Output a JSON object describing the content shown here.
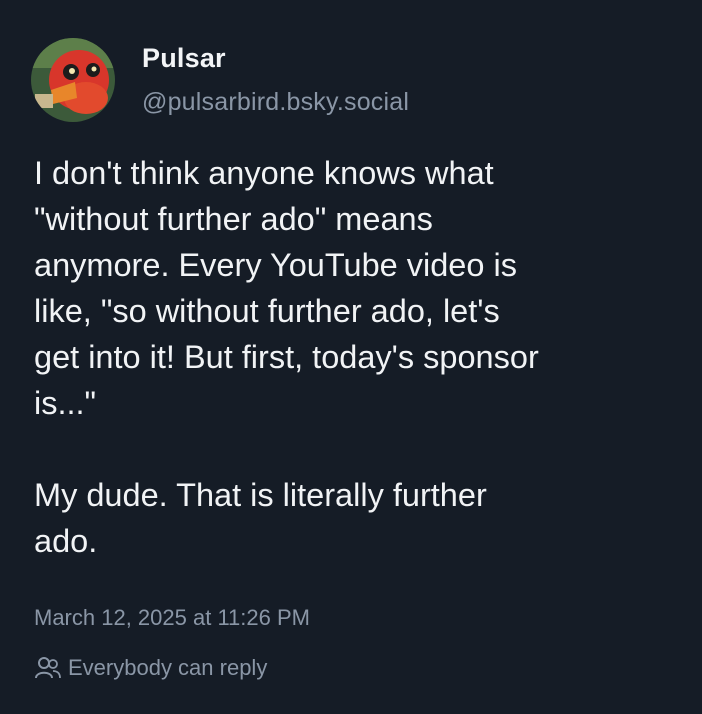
{
  "author": {
    "display_name": "Pulsar",
    "handle": "@pulsarbird.bsky.social",
    "avatar_icon": "avatar-image"
  },
  "post": {
    "text": "I don't think anyone knows what\n\"without further ado\" means\nanymore. Every YouTube video is\nlike, \"so without further ado, let's\nget into it! But first, today's sponsor\nis...\"\n\nMy dude. That is literally further\nado.",
    "timestamp": "March 12, 2025 at 11:26 PM"
  },
  "reply_setting": {
    "label": "Everybody can reply",
    "icon": "people-icon"
  },
  "colors": {
    "background": "#151c26",
    "text_primary": "#f1f3f5",
    "text_secondary": "#8a96a6"
  }
}
